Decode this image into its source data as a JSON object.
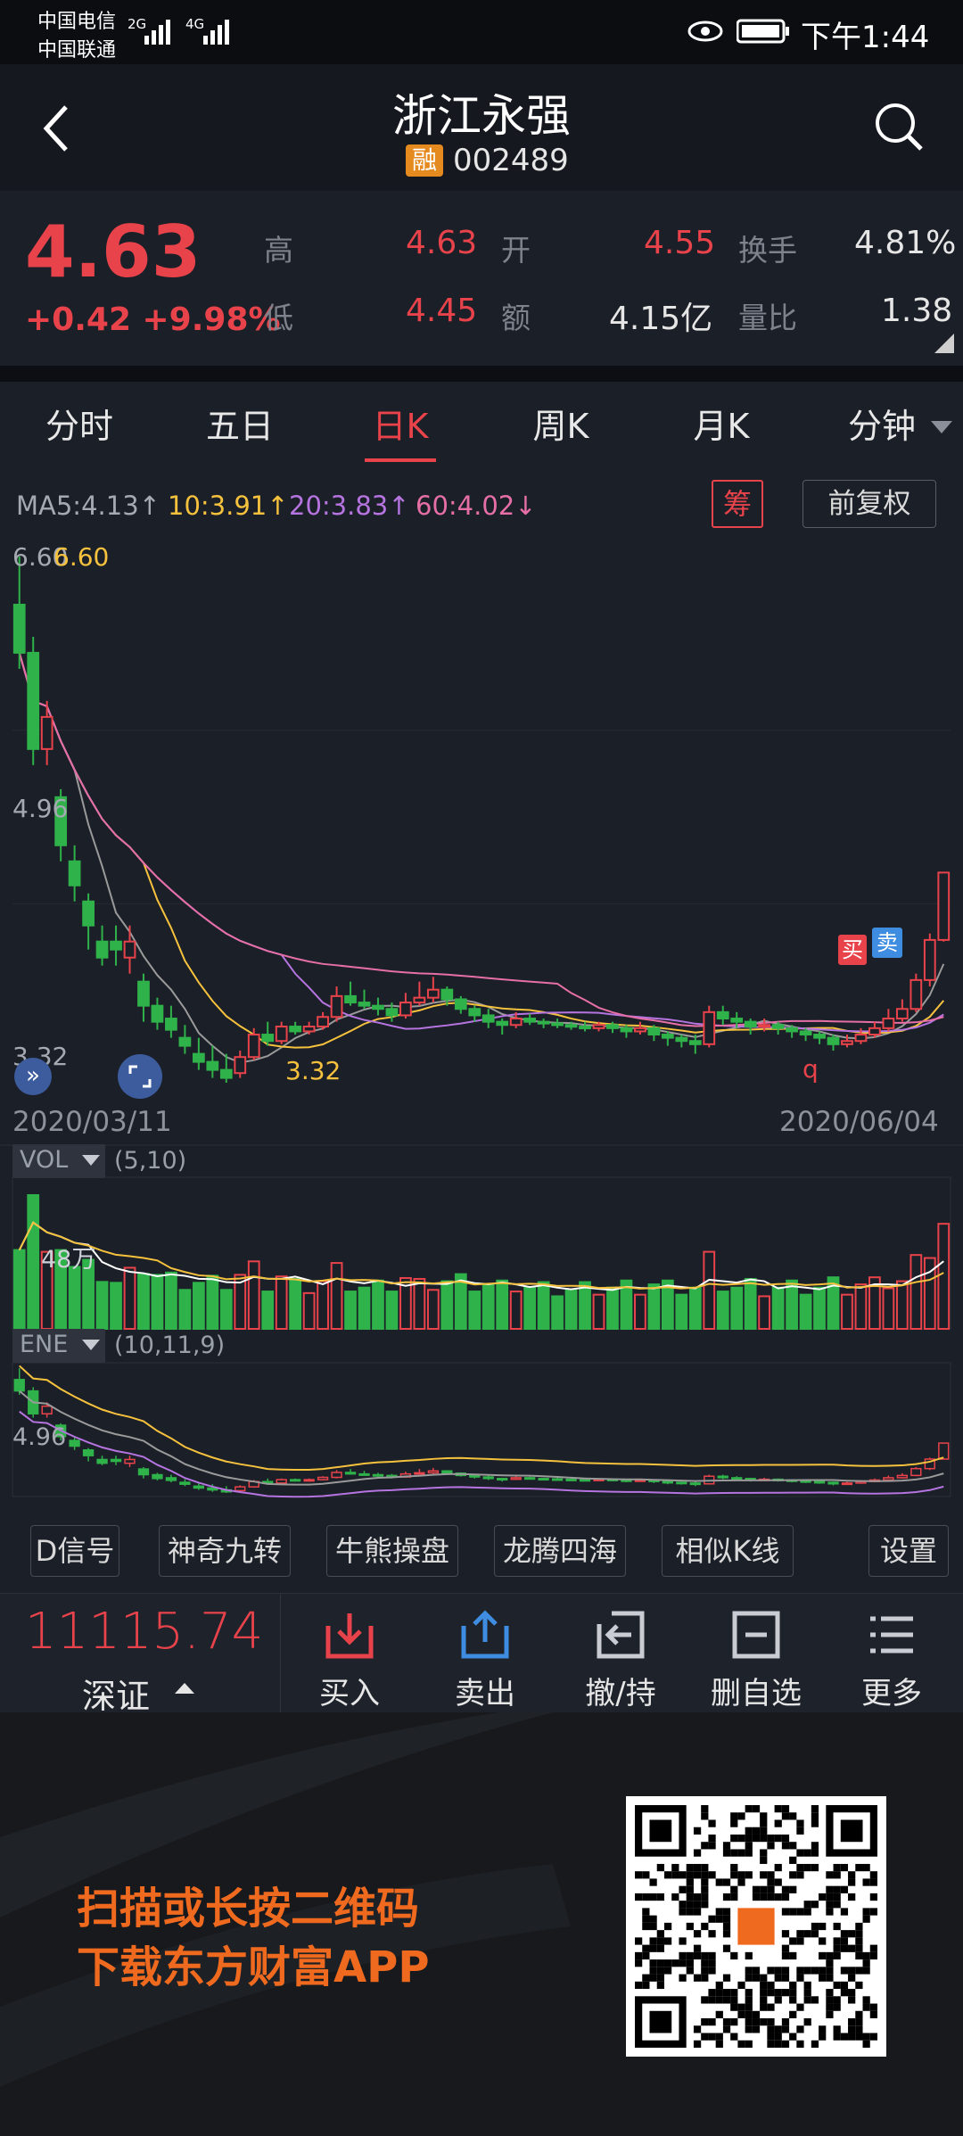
{
  "status": {
    "carrier1": "中国电信",
    "carrier2": "中国联通",
    "net1": "2G",
    "net2": "4G",
    "time": "下午1:44"
  },
  "header": {
    "title": "浙江永强",
    "badge": "融",
    "code": "002489"
  },
  "quote": {
    "price": "4.63",
    "change": "+0.42 +9.98%",
    "labels": {
      "high": "高",
      "low": "低",
      "open": "开",
      "amount": "额",
      "turnover": "换手",
      "vol_ratio": "量比"
    },
    "values": {
      "high": "4.63",
      "low": "4.45",
      "open": "4.55",
      "amount": "4.15亿",
      "turnover": "4.81%",
      "vol_ratio": "1.38"
    }
  },
  "tabs": [
    "分时",
    "五日",
    "日K",
    "周K",
    "月K",
    "分钟"
  ],
  "active_tab": "日K",
  "ma_legend": {
    "ma5": "MA5:4.13↑",
    "ma10": "10:3.91↑",
    "ma20": "20:3.83↑",
    "ma60": "60:4.02↓",
    "chip_btn": "筹",
    "adjust_btn": "前复权"
  },
  "chart_labels": {
    "y_top": "6.60",
    "y_top_mark": "6.60",
    "y_mid": "4.96",
    "y_low": "3.32",
    "low_mark": "3.32",
    "date_start": "2020/03/11",
    "date_end": "2020/06/04",
    "buy_mark": "买",
    "sell_mark": "卖",
    "q_mark": "q",
    "vol_label": "VOL",
    "vol_params": "(5,10)",
    "vol_value": "48万",
    "ene_label": "ENE",
    "ene_params": "(10,11,9)",
    "ene_value": "4.96"
  },
  "colors": {
    "up": "#e8434b",
    "down": "#2fb24a",
    "ma5": "#f6c23e",
    "ma10": "#9a9a9a",
    "ma20": "#b574e0",
    "ma60": "#e56fa6"
  },
  "chart_data": {
    "type": "candlestick",
    "x": [
      "2020/03/11",
      "2020/06/04"
    ],
    "ylim": [
      3.32,
      6.6
    ],
    "candles": [
      [
        6.3,
        6.0,
        6.6,
        5.9
      ],
      [
        6.0,
        5.4,
        6.1,
        5.3
      ],
      [
        5.4,
        5.6,
        5.7,
        5.3
      ],
      [
        5.1,
        4.8,
        5.15,
        4.7
      ],
      [
        4.7,
        4.55,
        4.8,
        4.45
      ],
      [
        4.45,
        4.3,
        4.5,
        4.15
      ],
      [
        4.2,
        4.1,
        4.3,
        4.05
      ],
      [
        4.2,
        4.15,
        4.3,
        4.05
      ],
      [
        4.1,
        4.2,
        4.3,
        4.0
      ],
      [
        3.95,
        3.8,
        4.0,
        3.7
      ],
      [
        3.8,
        3.7,
        3.85,
        3.65
      ],
      [
        3.72,
        3.65,
        3.8,
        3.6
      ],
      [
        3.6,
        3.55,
        3.68,
        3.5
      ],
      [
        3.5,
        3.45,
        3.6,
        3.4
      ],
      [
        3.45,
        3.4,
        3.55,
        3.35
      ],
      [
        3.4,
        3.35,
        3.5,
        3.32
      ],
      [
        3.38,
        3.48,
        3.52,
        3.35
      ],
      [
        3.48,
        3.62,
        3.66,
        3.46
      ],
      [
        3.62,
        3.58,
        3.7,
        3.55
      ],
      [
        3.58,
        3.67,
        3.7,
        3.56
      ],
      [
        3.67,
        3.64,
        3.7,
        3.62
      ],
      [
        3.64,
        3.67,
        3.7,
        3.62
      ],
      [
        3.67,
        3.73,
        3.76,
        3.65
      ],
      [
        3.73,
        3.86,
        3.92,
        3.7
      ],
      [
        3.86,
        3.82,
        3.95,
        3.8
      ],
      [
        3.82,
        3.8,
        3.9,
        3.78
      ],
      [
        3.8,
        3.78,
        3.85,
        3.74
      ],
      [
        3.78,
        3.74,
        3.82,
        3.7
      ],
      [
        3.74,
        3.82,
        3.88,
        3.72
      ],
      [
        3.82,
        3.85,
        3.95,
        3.8
      ],
      [
        3.85,
        3.9,
        3.98,
        3.82
      ],
      [
        3.9,
        3.84,
        3.92,
        3.8
      ],
      [
        3.84,
        3.78,
        3.86,
        3.75
      ],
      [
        3.78,
        3.74,
        3.8,
        3.7
      ],
      [
        3.74,
        3.7,
        3.78,
        3.66
      ],
      [
        3.7,
        3.68,
        3.72,
        3.62
      ],
      [
        3.68,
        3.72,
        3.76,
        3.66
      ],
      [
        3.72,
        3.7,
        3.75,
        3.68
      ],
      [
        3.7,
        3.69,
        3.72,
        3.66
      ],
      [
        3.69,
        3.68,
        3.72,
        3.66
      ],
      [
        3.68,
        3.67,
        3.7,
        3.65
      ],
      [
        3.67,
        3.66,
        3.7,
        3.64
      ],
      [
        3.66,
        3.68,
        3.7,
        3.64
      ],
      [
        3.68,
        3.66,
        3.7,
        3.63
      ],
      [
        3.66,
        3.64,
        3.68,
        3.6
      ],
      [
        3.64,
        3.66,
        3.7,
        3.62
      ],
      [
        3.66,
        3.62,
        3.68,
        3.58
      ],
      [
        3.62,
        3.6,
        3.64,
        3.55
      ],
      [
        3.6,
        3.58,
        3.62,
        3.54
      ],
      [
        3.58,
        3.56,
        3.62,
        3.5
      ],
      [
        3.56,
        3.76,
        3.8,
        3.54
      ],
      [
        3.76,
        3.72,
        3.8,
        3.68
      ],
      [
        3.72,
        3.7,
        3.76,
        3.66
      ],
      [
        3.7,
        3.67,
        3.72,
        3.62
      ],
      [
        3.67,
        3.68,
        3.72,
        3.64
      ],
      [
        3.68,
        3.66,
        3.7,
        3.62
      ],
      [
        3.66,
        3.64,
        3.68,
        3.6
      ],
      [
        3.64,
        3.62,
        3.66,
        3.58
      ],
      [
        3.62,
        3.6,
        3.64,
        3.56
      ],
      [
        3.6,
        3.56,
        3.62,
        3.52
      ],
      [
        3.56,
        3.58,
        3.62,
        3.54
      ],
      [
        3.58,
        3.62,
        3.66,
        3.56
      ],
      [
        3.62,
        3.66,
        3.7,
        3.6
      ],
      [
        3.66,
        3.72,
        3.78,
        3.64
      ],
      [
        3.72,
        3.78,
        3.84,
        3.7
      ],
      [
        3.78,
        3.96,
        4.0,
        3.76
      ],
      [
        3.96,
        4.21,
        4.25,
        3.92
      ],
      [
        4.21,
        4.63,
        4.63,
        4.2
      ]
    ],
    "volume_units": "万手"
  },
  "indicators": [
    "D信号",
    "神奇九转",
    "牛熊操盘",
    "龙腾四海",
    "相似K线",
    "设置"
  ],
  "bottom": {
    "index_value": "11115.74",
    "index_name": "深证",
    "actions": [
      "买入",
      "卖出",
      "撤/持",
      "删自选",
      "更多"
    ]
  },
  "promo": {
    "line1": "扫描或长按二维码",
    "line2": "下载东方财富APP"
  }
}
